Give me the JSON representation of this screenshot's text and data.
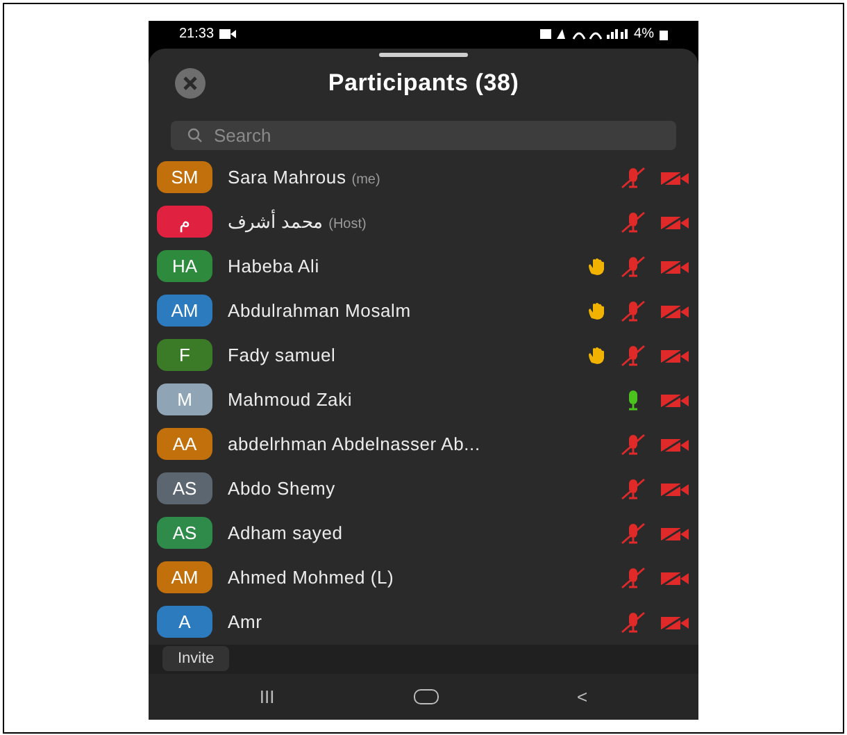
{
  "status_bar": {
    "time": "21:33",
    "battery": "4%"
  },
  "header": {
    "title": "Participants (38)"
  },
  "search": {
    "placeholder": "Search"
  },
  "participants": [
    {
      "initials": "SM",
      "color": "#c2700c",
      "name": "Sara Mahrous",
      "tag": "(me)",
      "hand_raised": false,
      "mic_on": false
    },
    {
      "initials": "م",
      "color": "#e0213f",
      "name": "محمد أشرف",
      "tag": "(Host)",
      "hand_raised": false,
      "mic_on": false
    },
    {
      "initials": "HA",
      "color": "#2e8b3e",
      "name": "Habeba Ali",
      "hand_raised": true,
      "mic_on": false
    },
    {
      "initials": "AM",
      "color": "#2c7bbf",
      "name": "Abdulrahman Mosalm",
      "hand_raised": true,
      "mic_on": false
    },
    {
      "initials": "F",
      "color": "#3b7a26",
      "name": "Fady samuel",
      "hand_raised": true,
      "mic_on": false
    },
    {
      "initials": "M",
      "color": "#8fa4b4",
      "name": "Mahmoud Zaki",
      "hand_raised": false,
      "mic_on": true
    },
    {
      "initials": "AA",
      "color": "#c2700c",
      "name": "abdelrhman Abdelnasser Ab...",
      "hand_raised": false,
      "mic_on": false
    },
    {
      "initials": "AS",
      "color": "#5c6670",
      "name": "Abdo Shemy",
      "hand_raised": false,
      "mic_on": false
    },
    {
      "initials": "AS",
      "color": "#2e8b4a",
      "name": "Adham sayed",
      "hand_raised": false,
      "mic_on": false
    },
    {
      "initials": "AM",
      "color": "#c2700c",
      "name": "Ahmed Mohmed (L)",
      "hand_raised": false,
      "mic_on": false
    },
    {
      "initials": "A",
      "color": "#2c7bbf",
      "name": "Amr",
      "hand_raised": false,
      "mic_on": false
    }
  ],
  "footer": {
    "invite_label": "Invite"
  },
  "nav_bar": {
    "recents": "III",
    "back": "<"
  }
}
